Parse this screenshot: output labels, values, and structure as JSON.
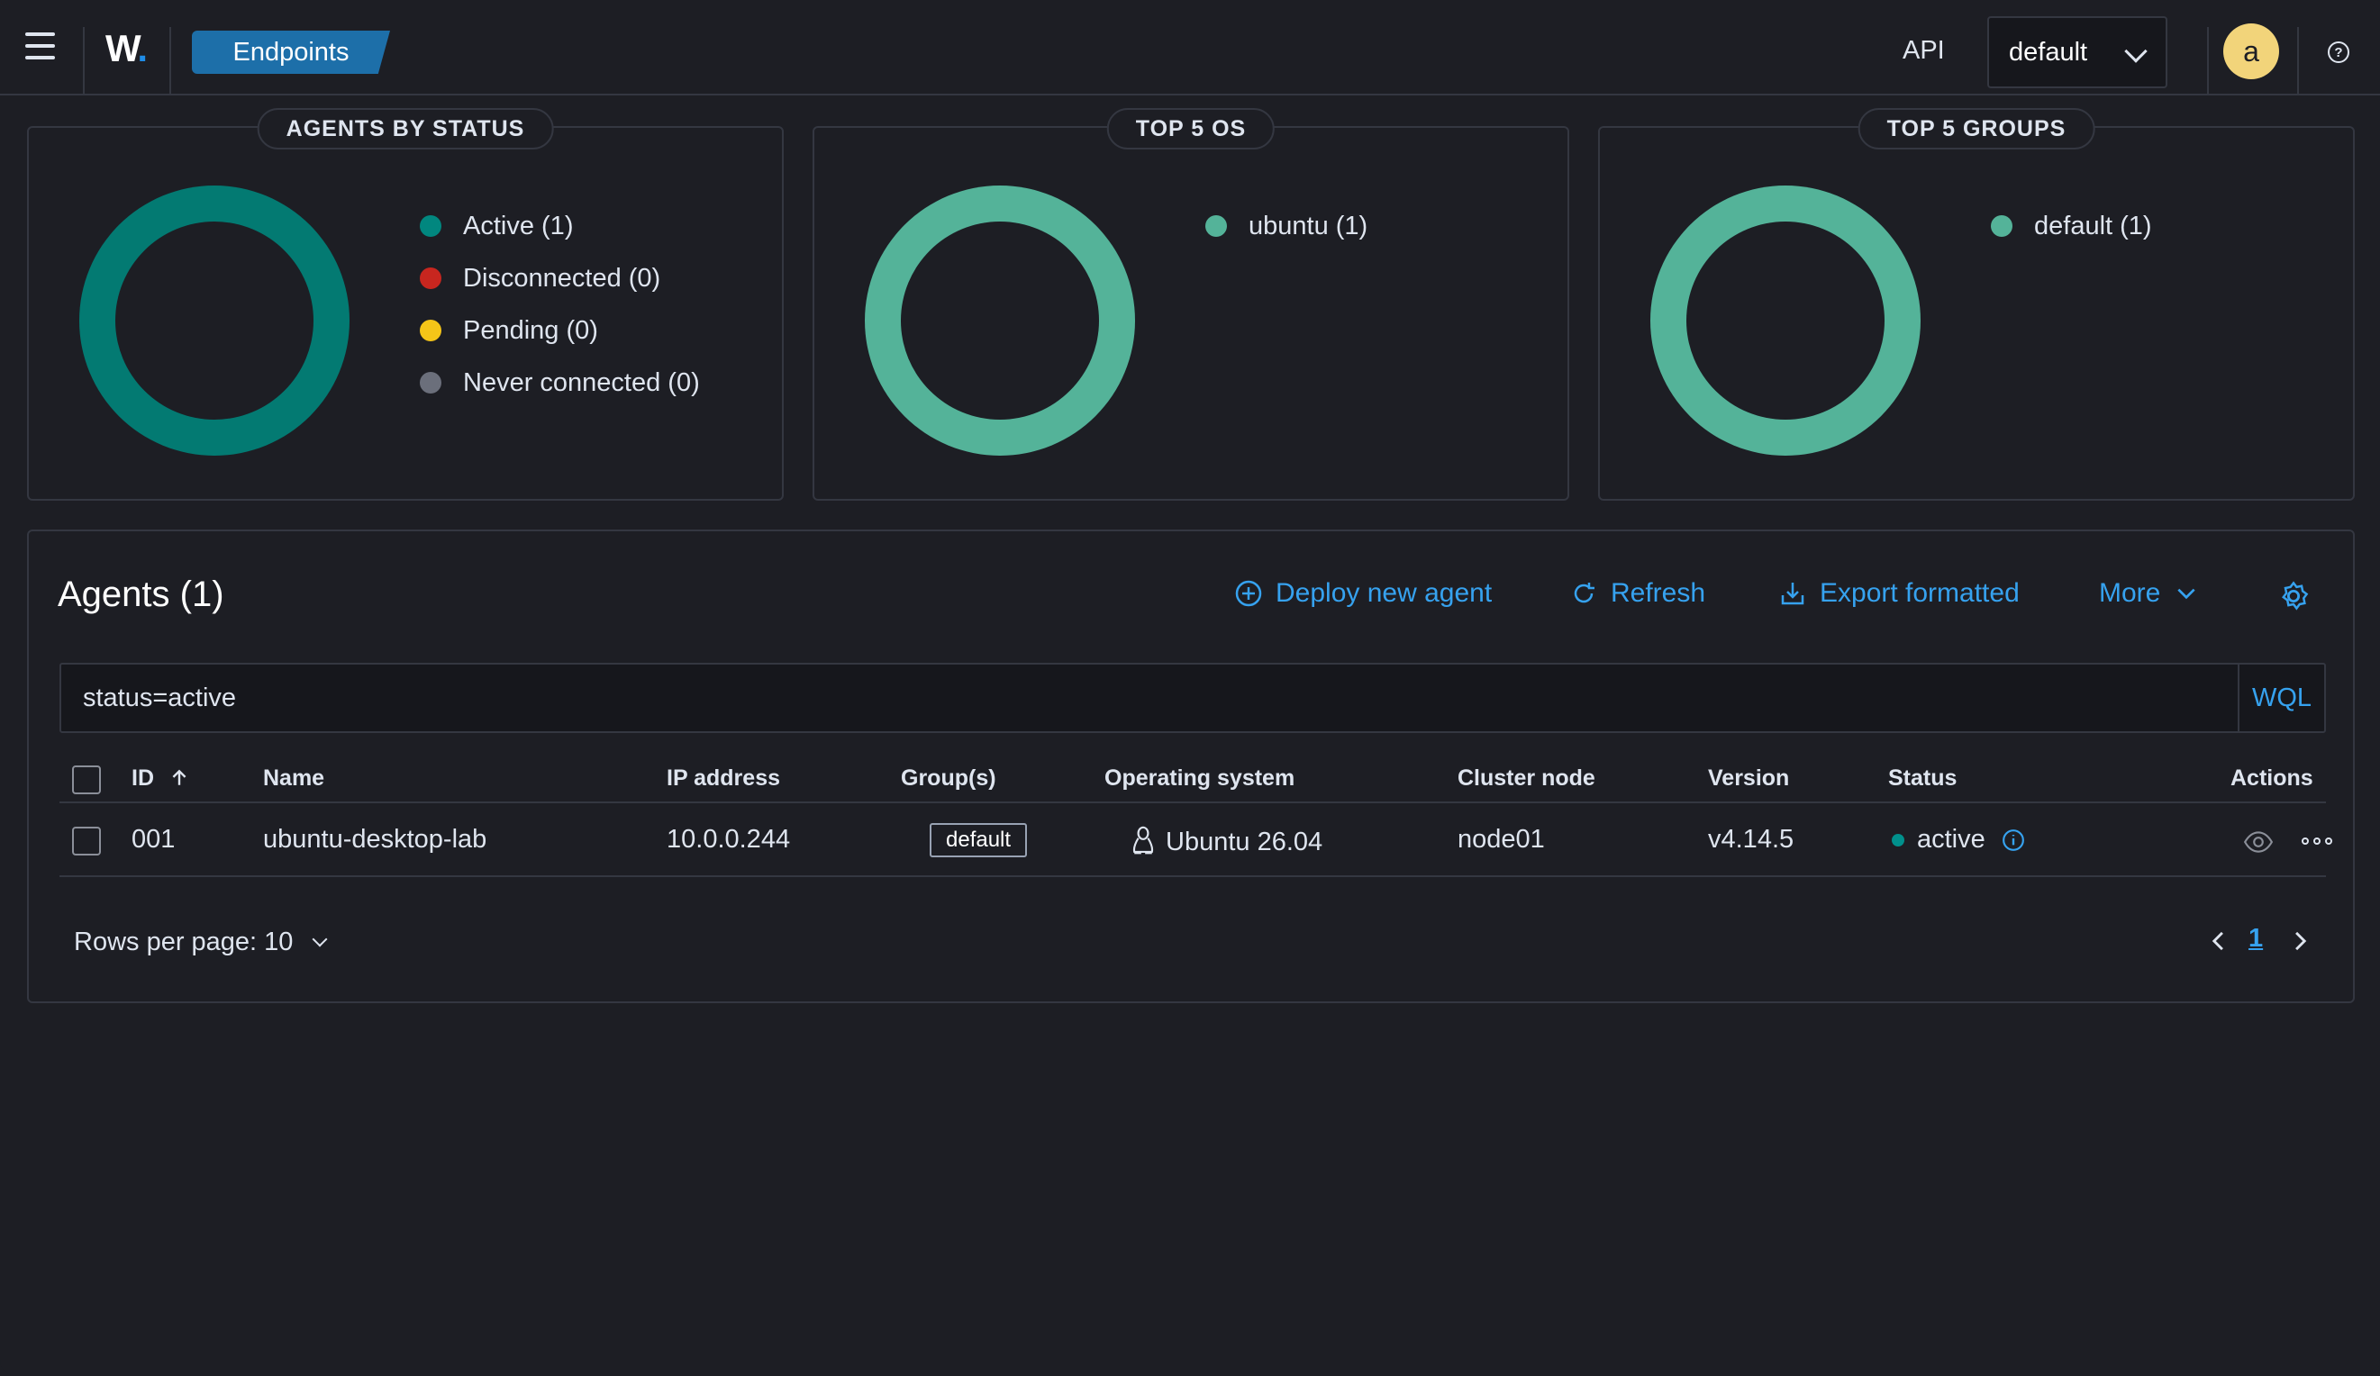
{
  "header": {
    "logo_letter": "W",
    "breadcrumb": "Endpoints",
    "api_label": "API",
    "environment": "default",
    "avatar_initial": "a",
    "help_glyph": "?"
  },
  "panels": [
    {
      "title": "AGENTS BY STATUS",
      "legend": [
        {
          "label": "Active (1)",
          "color": "#01877f"
        },
        {
          "label": "Disconnected (0)",
          "color": "#c8261f"
        },
        {
          "label": "Pending (0)",
          "color": "#f5c518"
        },
        {
          "label": "Never connected (0)",
          "color": "#6b6f7b"
        }
      ],
      "donut_color": "#037a72"
    },
    {
      "title": "TOP 5 OS",
      "legend": [
        {
          "label": "ubuntu (1)",
          "color": "#54b399"
        }
      ],
      "donut_color": "#54b399"
    },
    {
      "title": "TOP 5 GROUPS",
      "legend": [
        {
          "label": "default (1)",
          "color": "#54b399"
        }
      ],
      "donut_color": "#54b399"
    }
  ],
  "agents": {
    "title": "Agents (1)",
    "actions": {
      "deploy": "Deploy new agent",
      "refresh": "Refresh",
      "export": "Export formatted",
      "more": "More"
    },
    "search_value": "status=active",
    "wql_label": "WQL",
    "columns": {
      "id": "ID",
      "name": "Name",
      "ip": "IP address",
      "groups": "Group(s)",
      "os": "Operating system",
      "cluster": "Cluster node",
      "version": "Version",
      "status": "Status",
      "actions": "Actions"
    },
    "rows": [
      {
        "id": "001",
        "name": "ubuntu-desktop-lab",
        "ip": "10.0.0.244",
        "group": "default",
        "os": "Ubuntu 26.04",
        "cluster": "node01",
        "version": "v4.14.5",
        "status": "active"
      }
    ],
    "rows_per_page": "Rows per page: 10",
    "current_page": "1"
  },
  "colors": {
    "accent": "#36a2ef",
    "breadcrumb_bg": "#1d6fa9",
    "status_active": "#01908c"
  }
}
